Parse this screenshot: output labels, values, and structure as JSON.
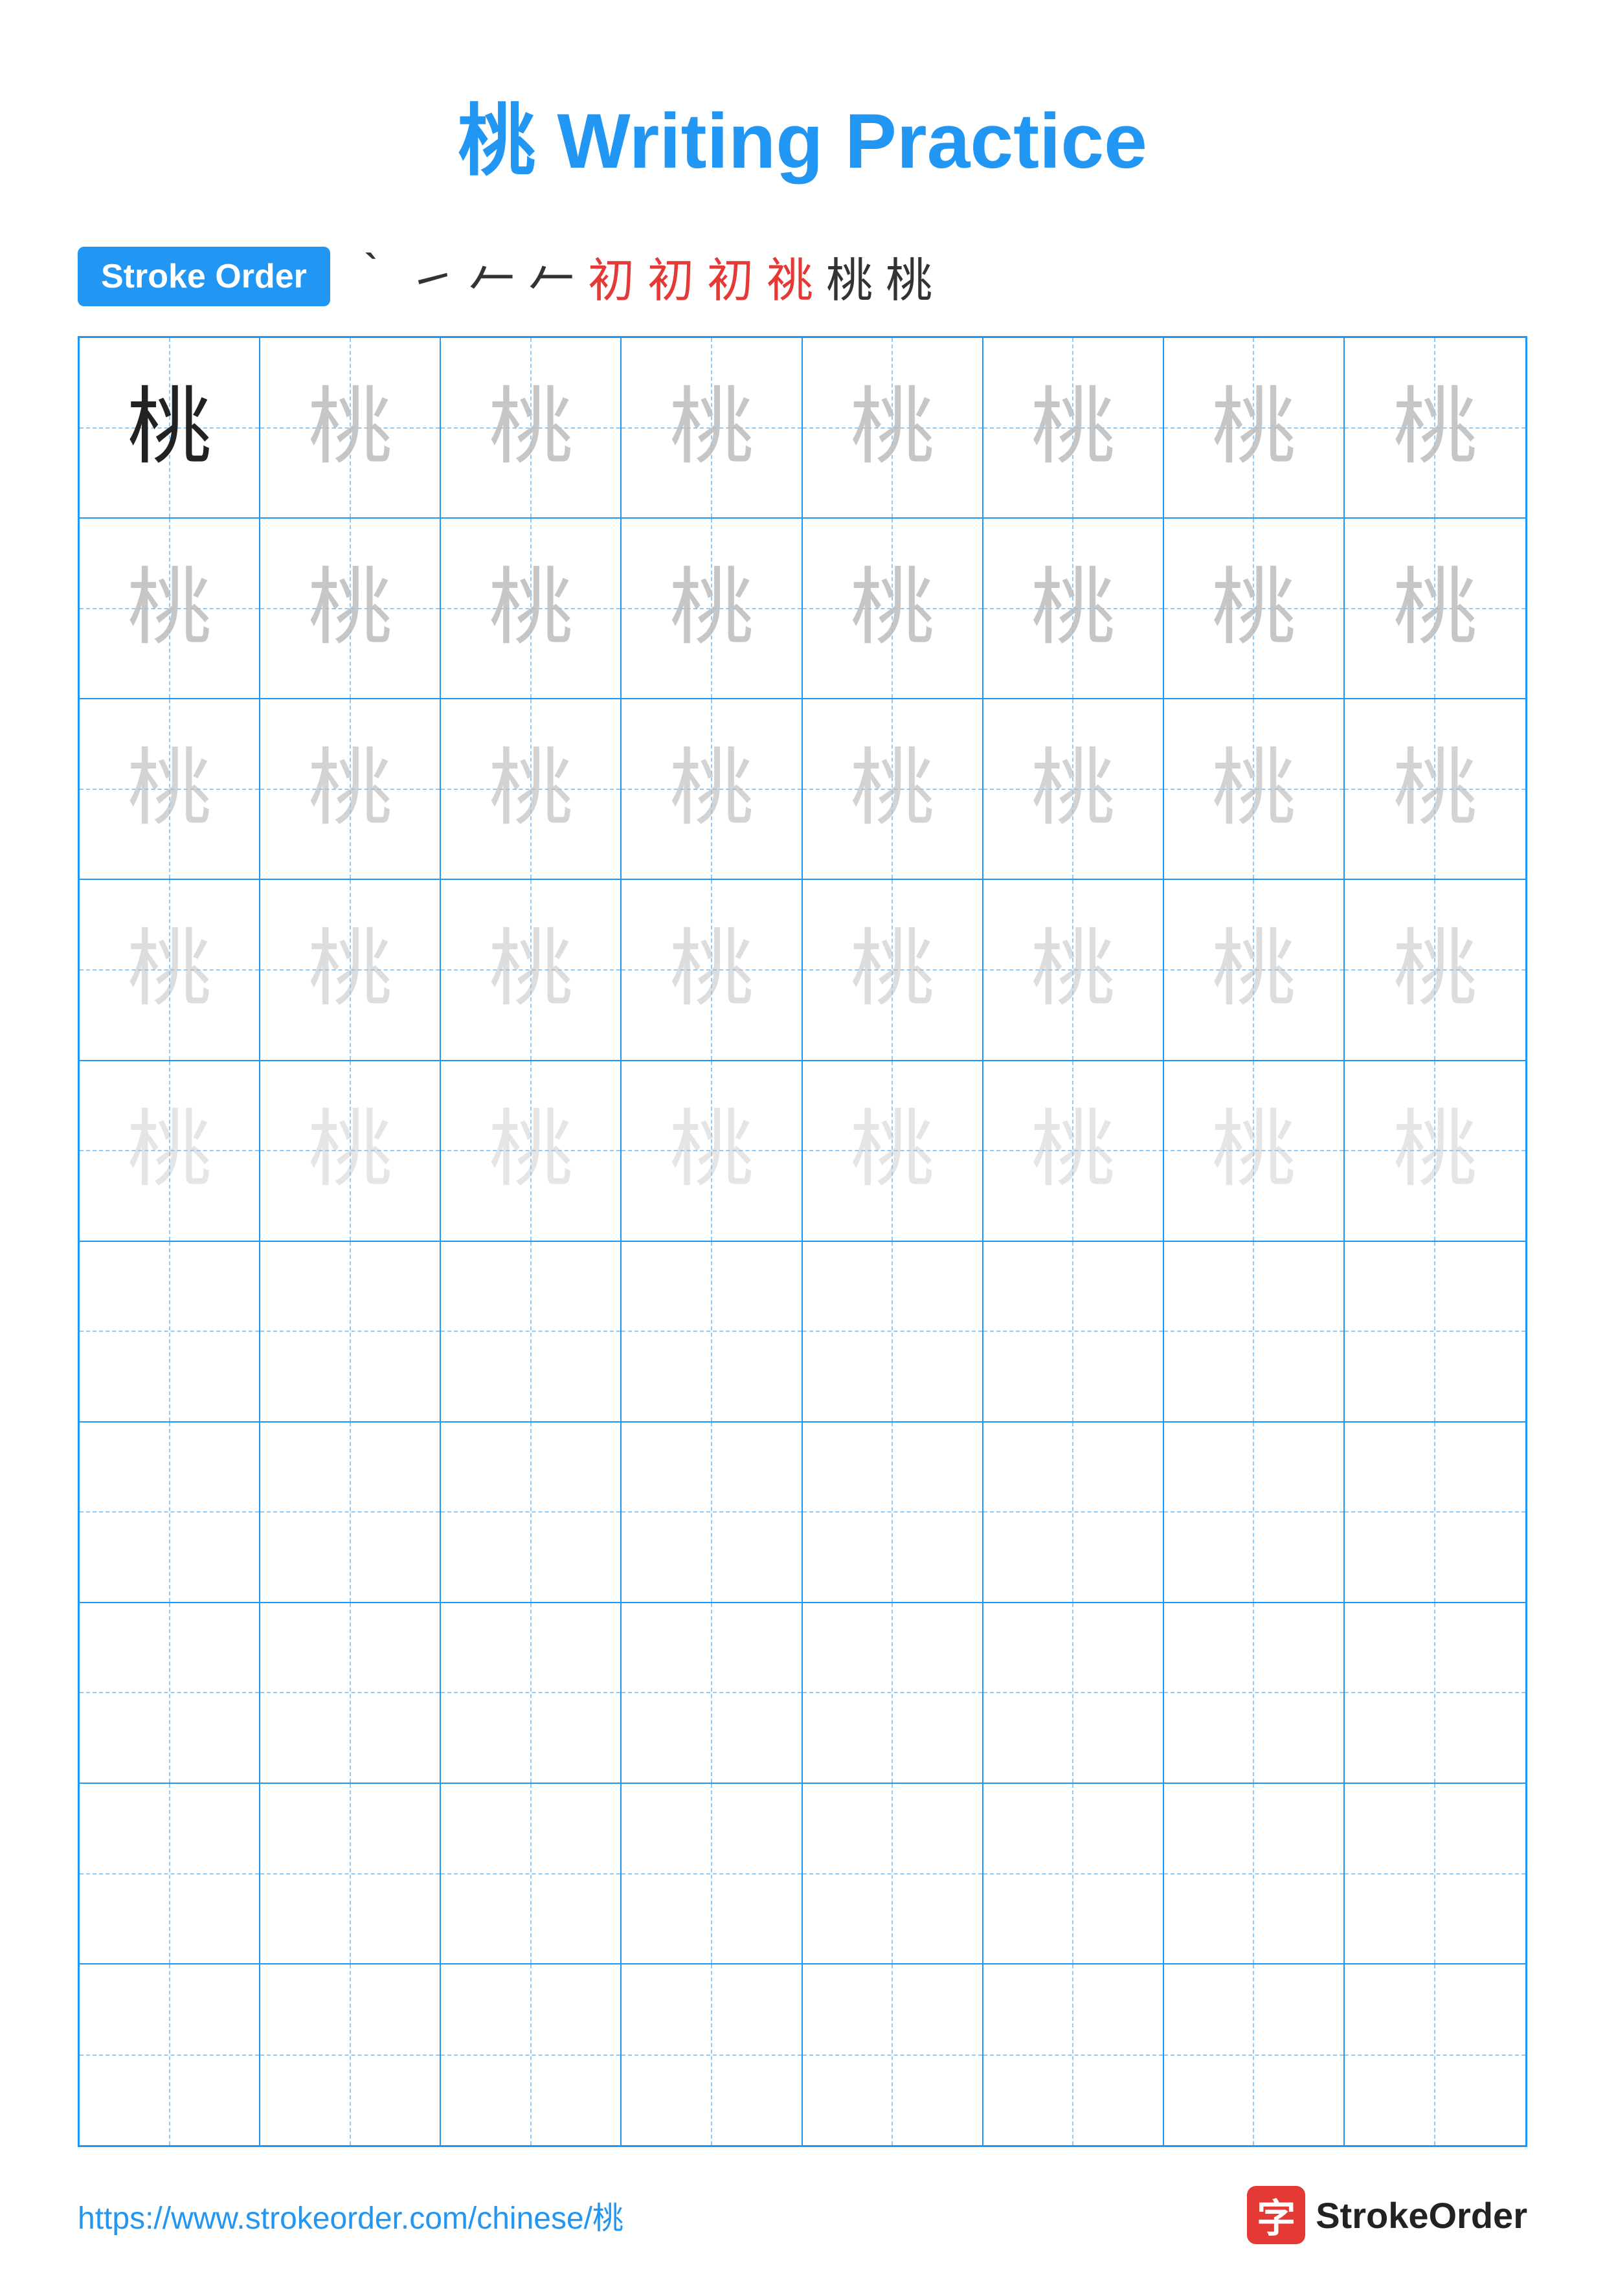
{
  "title": {
    "char": "桃",
    "text": " Writing Practice"
  },
  "stroke_order": {
    "badge_label": "Stroke Order",
    "strokes": [
      "｀",
      "㇀",
      "㇂",
      "㇒",
      "初",
      "初",
      "初",
      "祧",
      "桃",
      "桃"
    ]
  },
  "grid": {
    "rows": 10,
    "cols": 8,
    "char": "桃"
  },
  "footer": {
    "url": "https://www.strokeorder.com/chinese/桃",
    "logo_char": "字",
    "logo_text": "StrokeOrder"
  }
}
